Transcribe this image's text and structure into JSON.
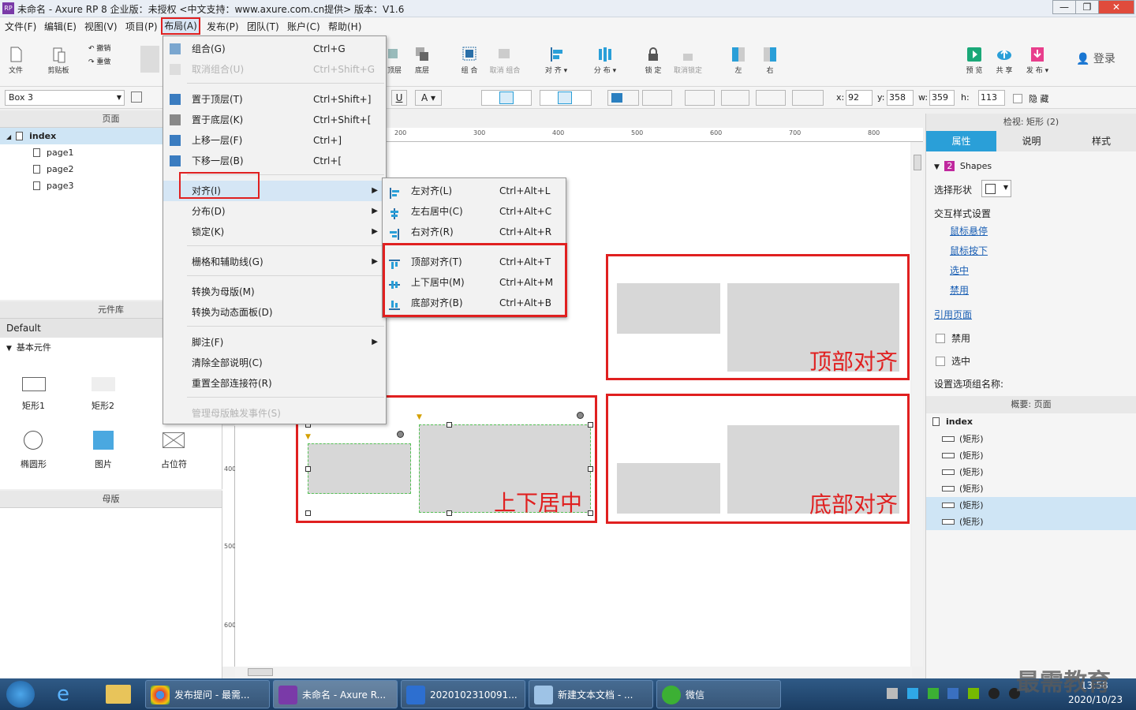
{
  "window": {
    "title": "未命名 - Axure RP 8 企业版：未授权    <中文支持：www.axure.com.cn提供> 版本：V1.6",
    "controls": [
      "—",
      "❐",
      "✕"
    ]
  },
  "menubar": {
    "items": [
      "文件(F)",
      "编辑(E)",
      "视图(V)",
      "项目(P)",
      "布局(A)",
      "发布(P)",
      "团队(T)",
      "账户(C)",
      "帮助(H)"
    ]
  },
  "toolbar": {
    "file": "文件",
    "clipboard": "剪贴板",
    "undo": "撤销",
    "redo": "重做",
    "top_layer": "顶层",
    "bottom_layer": "底层",
    "group": "组 合",
    "ungroup": "取消 组合",
    "align": "对 齐 ▾",
    "distribute": "分 布 ▾",
    "lock": "锁 定",
    "unlock": "取消锁定",
    "left": "左",
    "right": "右",
    "preview": "预 览",
    "share": "共 享",
    "publish": "发 布 ▾",
    "login": "登录"
  },
  "formatbar": {
    "widget_select": "Box 3",
    "x_label": "x:",
    "x": "92",
    "y_label": "y:",
    "y": "358",
    "w_label": "w:",
    "w": "359",
    "h_label": "h:",
    "h": "113",
    "hide": "隐 藏"
  },
  "pages_panel": {
    "title": "页面",
    "root": "index",
    "pages": [
      "page1",
      "page2",
      "page3"
    ]
  },
  "library_panel": {
    "title": "元件库",
    "library": "Default",
    "category": "基本元件",
    "widgets": [
      "矩形1",
      "矩形2",
      "椭圆形",
      "图片",
      "占位符"
    ]
  },
  "masters_panel": {
    "title": "母版"
  },
  "ruler": {
    "h_ticks": [
      "200",
      "300",
      "400",
      "500",
      "600",
      "700",
      "800"
    ],
    "v_ticks": [
      "400",
      "500",
      "600"
    ]
  },
  "canvas": {
    "label_top": "顶部对齐",
    "label_middle": "上下居中",
    "label_bottom": "底部对齐"
  },
  "layout_menu": {
    "items": [
      {
        "label": "组合(G)",
        "shortcut": "Ctrl+G",
        "disabled": false
      },
      {
        "label": "取消组合(U)",
        "shortcut": "Ctrl+Shift+G",
        "disabled": true
      },
      {
        "label": "置于顶层(T)",
        "shortcut": "Ctrl+Shift+]",
        "disabled": false
      },
      {
        "label": "置于底层(K)",
        "shortcut": "Ctrl+Shift+[",
        "disabled": false
      },
      {
        "label": "上移一层(F)",
        "shortcut": "Ctrl+]",
        "disabled": false
      },
      {
        "label": "下移一层(B)",
        "shortcut": "Ctrl+[",
        "disabled": false
      },
      {
        "label": "对齐(I)",
        "shortcut": "",
        "disabled": false
      },
      {
        "label": "分布(D)",
        "shortcut": "",
        "disabled": false
      },
      {
        "label": "锁定(K)",
        "shortcut": "",
        "disabled": false
      },
      {
        "label": "栅格和辅助线(G)",
        "shortcut": "",
        "disabled": false
      },
      {
        "label": "转换为母版(M)",
        "shortcut": "",
        "disabled": false
      },
      {
        "label": "转换为动态面板(D)",
        "shortcut": "",
        "disabled": false
      },
      {
        "label": "脚注(F)",
        "shortcut": "",
        "disabled": false
      },
      {
        "label": "清除全部说明(C)",
        "shortcut": "",
        "disabled": false
      },
      {
        "label": "重置全部连接符(R)",
        "shortcut": "",
        "disabled": false
      },
      {
        "label": "管理母版触发事件(S)",
        "shortcut": "",
        "disabled": true
      }
    ]
  },
  "align_submenu": {
    "items": [
      {
        "label": "左对齐(L)",
        "shortcut": "Ctrl+Alt+L"
      },
      {
        "label": "左右居中(C)",
        "shortcut": "Ctrl+Alt+C"
      },
      {
        "label": "右对齐(R)",
        "shortcut": "Ctrl+Alt+R"
      },
      {
        "label": "顶部对齐(T)",
        "shortcut": "Ctrl+Alt+T"
      },
      {
        "label": "上下居中(M)",
        "shortcut": "Ctrl+Alt+M"
      },
      {
        "label": "底部对齐(B)",
        "shortcut": "Ctrl+Alt+B"
      }
    ]
  },
  "inspector": {
    "title": "检视: 矩形 (2)",
    "tabs": [
      "属性",
      "说明",
      "样式"
    ],
    "shapes_count": "2",
    "shapes_label": "Shapes",
    "select_shape": "选择形状",
    "interaction_styles": "交互样式设置",
    "hover": "鼠标悬停",
    "mouse_down": "鼠标按下",
    "selected": "选中",
    "disabled": "禁用",
    "ref_page": "引用页面",
    "cb_disabled": "禁用",
    "cb_selected": "选中",
    "option_group": "设置选项组名称:"
  },
  "outline": {
    "title": "概要: 页面",
    "root": "index",
    "items": [
      "(矩形)",
      "(矩形)",
      "(矩形)",
      "(矩形)",
      "(矩形)",
      "(矩形)"
    ]
  },
  "taskbar": {
    "tasks": [
      "发布提问 - 最需...",
      "未命名 - Axure R...",
      "2020102310091...",
      "新建文本文档 - ...",
      "微信"
    ],
    "time": "13:58",
    "date": "2020/10/23",
    "watermark": "最需教育"
  },
  "colors": {
    "accent": "#2a9fd8",
    "highlight_red": "#e02020",
    "shape_fill": "#d7d7d7"
  }
}
